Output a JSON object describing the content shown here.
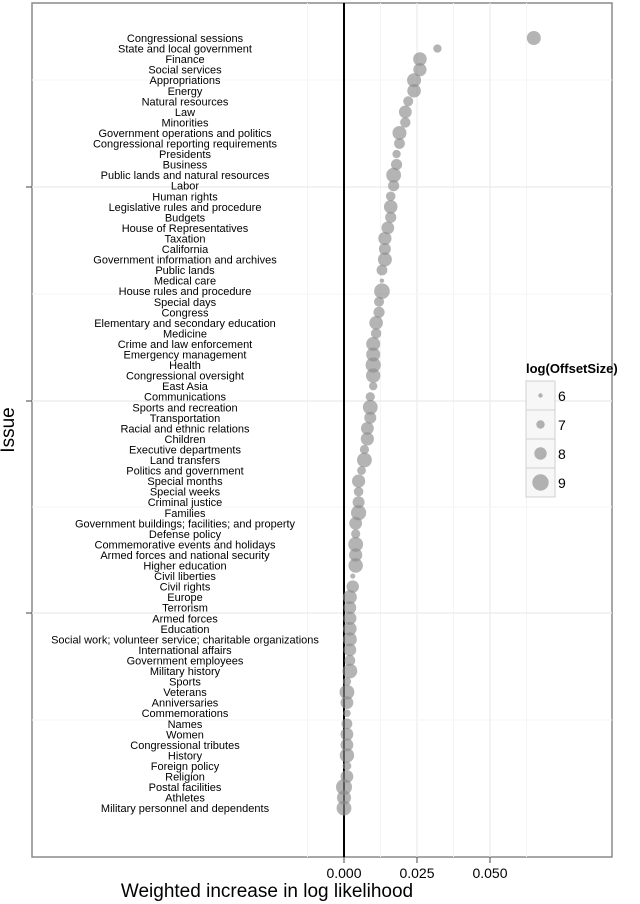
{
  "chart_data": {
    "type": "scatter",
    "title": "",
    "xlabel": "Weighted increase in log likelihood",
    "ylabel": "Issue",
    "xlim": [
      -0.1,
      0.09
    ],
    "x_ticks": [
      0.0,
      0.025,
      0.05
    ],
    "x_tick_labels": [
      "0.000",
      "0.025",
      "0.050"
    ],
    "reference_line_x": 0.0,
    "grid": true,
    "legend": {
      "title": "log(OffsetSize)",
      "placement": "right",
      "entries": [
        {
          "label": "6",
          "value": 6
        },
        {
          "label": "7",
          "value": 7
        },
        {
          "label": "8",
          "value": 8
        },
        {
          "label": "9",
          "value": 9
        }
      ]
    },
    "marker_color": "#8c8c8c",
    "marker_opacity": 0.65,
    "points": [
      {
        "issue": "Congressional sessions",
        "x": 0.065,
        "size": 8.4
      },
      {
        "issue": "State and local government",
        "x": 0.032,
        "size": 7.0
      },
      {
        "issue": "Finance",
        "x": 0.026,
        "size": 8.3
      },
      {
        "issue": "Social services",
        "x": 0.026,
        "size": 8.2
      },
      {
        "issue": "Appropriations",
        "x": 0.024,
        "size": 8.4
      },
      {
        "issue": "Energy",
        "x": 0.024,
        "size": 8.3
      },
      {
        "issue": "Natural resources",
        "x": 0.022,
        "size": 7.4
      },
      {
        "issue": "Law",
        "x": 0.021,
        "size": 8.1
      },
      {
        "issue": "Minorities",
        "x": 0.021,
        "size": 7.5
      },
      {
        "issue": "Government operations and politics",
        "x": 0.019,
        "size": 8.4
      },
      {
        "issue": "Congressional reporting requirements",
        "x": 0.019,
        "size": 7.6
      },
      {
        "issue": "Presidents",
        "x": 0.018,
        "size": 7.0
      },
      {
        "issue": "Business",
        "x": 0.018,
        "size": 7.7
      },
      {
        "issue": "Public lands and natural resources",
        "x": 0.017,
        "size": 8.6
      },
      {
        "issue": "Labor",
        "x": 0.017,
        "size": 7.7
      },
      {
        "issue": "Human rights",
        "x": 0.016,
        "size": 7.3
      },
      {
        "issue": "Legislative rules and procedure",
        "x": 0.016,
        "size": 8.3
      },
      {
        "issue": "Budgets",
        "x": 0.016,
        "size": 7.7
      },
      {
        "issue": "House of Representatives",
        "x": 0.015,
        "size": 8.1
      },
      {
        "issue": "Taxation",
        "x": 0.014,
        "size": 8.2
      },
      {
        "issue": "California",
        "x": 0.014,
        "size": 7.9
      },
      {
        "issue": "Government information and archives",
        "x": 0.014,
        "size": 8.4
      },
      {
        "issue": "Public lands",
        "x": 0.013,
        "size": 7.6
      },
      {
        "issue": "Medical care",
        "x": 0.013,
        "size": 6.0
      },
      {
        "issue": "House rules and procedure",
        "x": 0.013,
        "size": 8.8
      },
      {
        "issue": "Special days",
        "x": 0.012,
        "size": 7.4
      },
      {
        "issue": "Congress",
        "x": 0.012,
        "size": 7.7
      },
      {
        "issue": "Elementary and secondary education",
        "x": 0.011,
        "size": 8.3
      },
      {
        "issue": "Medicine",
        "x": 0.011,
        "size": 7.5
      },
      {
        "issue": "Crime and law enforcement",
        "x": 0.01,
        "size": 8.4
      },
      {
        "issue": "Emergency management",
        "x": 0.01,
        "size": 8.4
      },
      {
        "issue": "Health",
        "x": 0.01,
        "size": 8.7
      },
      {
        "issue": "Congressional oversight",
        "x": 0.01,
        "size": 8.5
      },
      {
        "issue": "East Asia",
        "x": 0.01,
        "size": 7.0
      },
      {
        "issue": "Communications",
        "x": 0.009,
        "size": 7.2
      },
      {
        "issue": "Sports and recreation",
        "x": 0.009,
        "size": 8.6
      },
      {
        "issue": "Transportation",
        "x": 0.009,
        "size": 7.9
      },
      {
        "issue": "Racial and ethnic relations",
        "x": 0.008,
        "size": 8.1
      },
      {
        "issue": "Children",
        "x": 0.008,
        "size": 8.2
      },
      {
        "issue": "Executive departments",
        "x": 0.007,
        "size": 7.2
      },
      {
        "issue": "Land transfers",
        "x": 0.007,
        "size": 8.6
      },
      {
        "issue": "Politics and government",
        "x": 0.006,
        "size": 7.1
      },
      {
        "issue": "Special months",
        "x": 0.005,
        "size": 8.2
      },
      {
        "issue": "Special weeks",
        "x": 0.005,
        "size": 7.3
      },
      {
        "issue": "Criminal justice",
        "x": 0.005,
        "size": 7.9
      },
      {
        "issue": "Families",
        "x": 0.005,
        "size": 8.7
      },
      {
        "issue": "Government buildings; facilities; and property",
        "x": 0.004,
        "size": 8.1
      },
      {
        "issue": "Defense policy",
        "x": 0.004,
        "size": 7.2
      },
      {
        "issue": "Commemorative events and holidays",
        "x": 0.004,
        "size": 8.6
      },
      {
        "issue": "Armed forces and national security",
        "x": 0.004,
        "size": 8.2
      },
      {
        "issue": "Higher education",
        "x": 0.004,
        "size": 8.5
      },
      {
        "issue": "Civil liberties",
        "x": 0.003,
        "size": 6.2
      },
      {
        "issue": "Civil rights",
        "x": 0.003,
        "size": 8.0
      },
      {
        "issue": "Europe",
        "x": 0.002,
        "size": 8.4
      },
      {
        "issue": "Terrorism",
        "x": 0.002,
        "size": 8.1
      },
      {
        "issue": "Armed forces",
        "x": 0.002,
        "size": 8.2
      },
      {
        "issue": "Education",
        "x": 0.002,
        "size": 8.3
      },
      {
        "issue": "Social work; volunteer service; charitable organizations",
        "x": 0.002,
        "size": 8.4
      },
      {
        "issue": "International affairs",
        "x": 0.002,
        "size": 8.1
      },
      {
        "issue": "Government employees",
        "x": 0.002,
        "size": 7.6
      },
      {
        "issue": "Military history",
        "x": 0.002,
        "size": 8.6
      },
      {
        "issue": "Sports",
        "x": 0.001,
        "size": 7.0
      },
      {
        "issue": "Veterans",
        "x": 0.001,
        "size": 8.6
      },
      {
        "issue": "Anniversaries",
        "x": 0.001,
        "size": 8.1
      },
      {
        "issue": "Commemorations",
        "x": 0.001,
        "size": 6.8
      },
      {
        "issue": "Names",
        "x": 0.001,
        "size": 7.6
      },
      {
        "issue": "Women",
        "x": 0.001,
        "size": 8.1
      },
      {
        "issue": "Congressional tributes",
        "x": 0.001,
        "size": 8.1
      },
      {
        "issue": "History",
        "x": 0.001,
        "size": 8.5
      },
      {
        "issue": "Foreign policy",
        "x": 0.001,
        "size": 7.1
      },
      {
        "issue": "Religion",
        "x": 0.001,
        "size": 8.1
      },
      {
        "issue": "Postal facilities",
        "x": 0.0,
        "size": 8.9
      },
      {
        "issue": "Athletes",
        "x": 0.0,
        "size": 8.4
      },
      {
        "issue": "Military personnel and dependents",
        "x": 0.0,
        "size": 8.6
      }
    ]
  }
}
